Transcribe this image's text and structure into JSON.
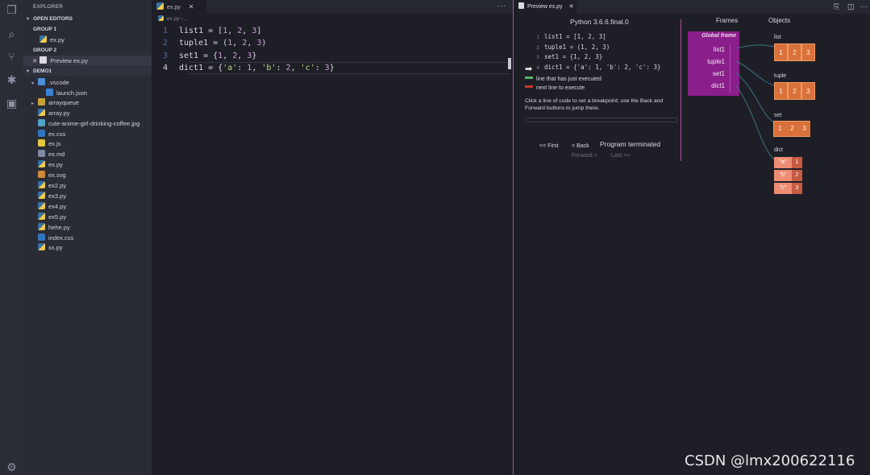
{
  "sidebar": {
    "title": "EXPLORER",
    "open_editors": "OPEN EDITORS",
    "group1": "GROUP 1",
    "group1_file": "ex.py",
    "group2": "GROUP 2",
    "group2_file": "Preview ex.py",
    "workspace": "DEMO1",
    "files": [
      ".vscode",
      "launch.json",
      "arrayqueue",
      "array.py",
      "cute-anime-girl-drinking-coffee.jpg",
      "ex.css",
      "ex.js",
      "ex.md",
      "ex.py",
      "ex.svg",
      "ex2.py",
      "ex3.py",
      "ex4.py",
      "ex5.py",
      "hehe.py",
      "index.css",
      "xx.py"
    ]
  },
  "editor": {
    "tab_label": "ex.py",
    "breadcrumb_file": "ex.py",
    "breadcrumb_more": "...",
    "line_numbers": [
      "1",
      "2",
      "3",
      "4"
    ],
    "lines": [
      {
        "a": "list1 = [",
        "n1": "1",
        "s1": ", ",
        "n2": "2",
        "s2": ", ",
        "n3": "3",
        "e": "]"
      },
      {
        "a": "tuple1 = (",
        "n1": "1",
        "s1": ", ",
        "n2": "2",
        "s2": ", ",
        "n3": "3",
        "e": ")"
      },
      {
        "a": "set1 = {",
        "n1": "1",
        "s1": ", ",
        "n2": "2",
        "s2": ", ",
        "n3": "3",
        "e": "}"
      }
    ],
    "line4": {
      "a": "dict1 = {",
      "k1": "'a'",
      "c1": ": ",
      "v1": "1",
      "p1": ", ",
      "k2": "'b'",
      "c2": ": ",
      "v2": "2",
      "p2": ", ",
      "k3": "'c'",
      "c3": ": ",
      "v3": "3",
      "e": "}"
    }
  },
  "preview": {
    "tab_label": "Preview ex.py",
    "python_version": "Python 3.6.6.final.0",
    "code_lines": [
      {
        "n": "1",
        "t": "list1 = [1, 2, 3]"
      },
      {
        "n": "2",
        "t": "tuple1 = (1, 2, 3)"
      },
      {
        "n": "3",
        "t": "set1 = {1, 2, 3}"
      },
      {
        "n": "4",
        "t": "dict1 = {'a': 1, 'b': 2, 'c': 3}"
      }
    ],
    "legend_executed": "line that has just executed",
    "legend_next": "next line to execute",
    "hint": "Click a line of code to set a breakpoint; use the Back and Forward buttons to jump there.",
    "btn_first": "<< First",
    "btn_back": "< Back",
    "status": "Program terminated",
    "btn_forward": "Forward >",
    "btn_last": "Last >>",
    "frames_header": "Frames",
    "objects_header": "Objects",
    "global_frame": "Global frame",
    "vars": [
      "list1",
      "tuple1",
      "set1",
      "dict1"
    ],
    "list_label": "list",
    "list_vals": [
      "1",
      "2",
      "3"
    ],
    "tuple_label": "tuple",
    "tuple_vals": [
      "1",
      "2",
      "3"
    ],
    "set_label": "set",
    "set_vals": [
      "1",
      "2",
      "3"
    ],
    "dict_label": "dict",
    "dict_keys": [
      "\"a\"",
      "\"b\"",
      "\"c\""
    ],
    "dict_vals": [
      "1",
      "2",
      "3"
    ],
    "colors": {
      "frame": "#8a1e8a",
      "object": "#d9713b",
      "dict_key": "#ef8d74",
      "executed_arrow": "#58b368",
      "next_arrow": "#c0392b"
    }
  },
  "watermark": "CSDN @lmx200622116"
}
